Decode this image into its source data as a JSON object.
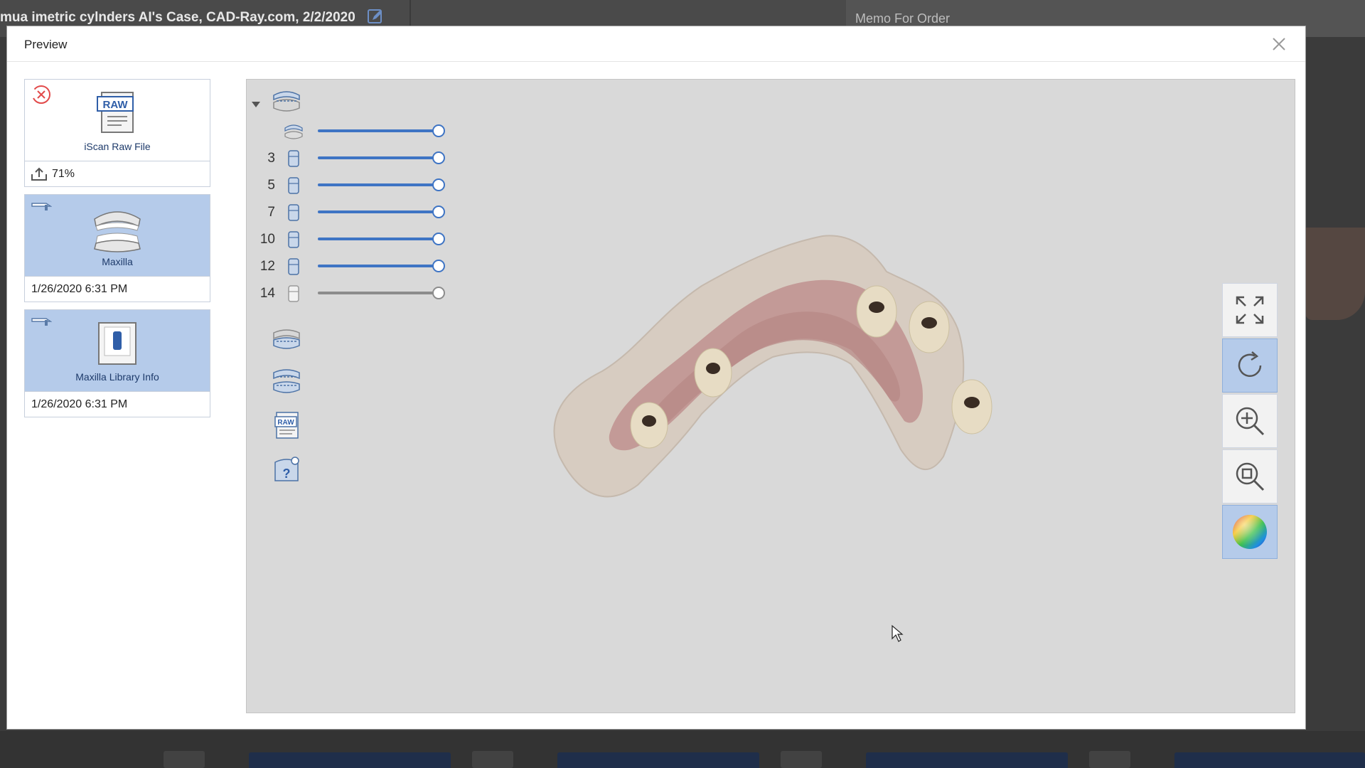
{
  "background": {
    "window_title": "mua imetric cylnders AI's Case, CAD-Ray.com, 2/2/2020",
    "memo_label": "Memo For Order"
  },
  "modal": {
    "title": "Preview"
  },
  "files": [
    {
      "label": "iScan Raw File",
      "status_icon": "error-icon",
      "progress": "71%",
      "selected": false
    },
    {
      "label": "Maxilla",
      "date": "1/26/2020 6:31 PM",
      "selected": true
    },
    {
      "label": "Maxilla Library Info",
      "date": "1/26/2020 6:31 PM",
      "selected": true
    }
  ],
  "layers": [
    {
      "number": "",
      "icon": "arch-icon",
      "level": 1.0,
      "enabled": true
    },
    {
      "number": "3",
      "icon": "tooth-icon",
      "level": 1.0,
      "enabled": true
    },
    {
      "number": "5",
      "icon": "tooth-icon",
      "level": 1.0,
      "enabled": true
    },
    {
      "number": "7",
      "icon": "tooth-icon",
      "level": 1.0,
      "enabled": true
    },
    {
      "number": "10",
      "icon": "tooth-icon",
      "level": 1.0,
      "enabled": true
    },
    {
      "number": "12",
      "icon": "tooth-icon",
      "level": 1.0,
      "enabled": true
    },
    {
      "number": "14",
      "icon": "tooth-icon",
      "level": 1.0,
      "enabled": false
    }
  ],
  "side_icons": [
    "lower-arch-icon",
    "both-arches-icon",
    "raw-file-icon",
    "library-info-icon"
  ],
  "toolbar": [
    {
      "name": "fit-view-button",
      "icon": "expand-icon",
      "active": false
    },
    {
      "name": "reset-view-button",
      "icon": "refresh-icon",
      "active": true
    },
    {
      "name": "zoom-in-button",
      "icon": "zoom-in-icon",
      "active": false
    },
    {
      "name": "zoom-fit-button",
      "icon": "zoom-fit-icon",
      "active": false
    },
    {
      "name": "color-map-button",
      "icon": "color-sphere-icon",
      "active": true
    }
  ],
  "colors": {
    "accent": "#3e74c4",
    "selected_bg": "#b5cbea"
  }
}
